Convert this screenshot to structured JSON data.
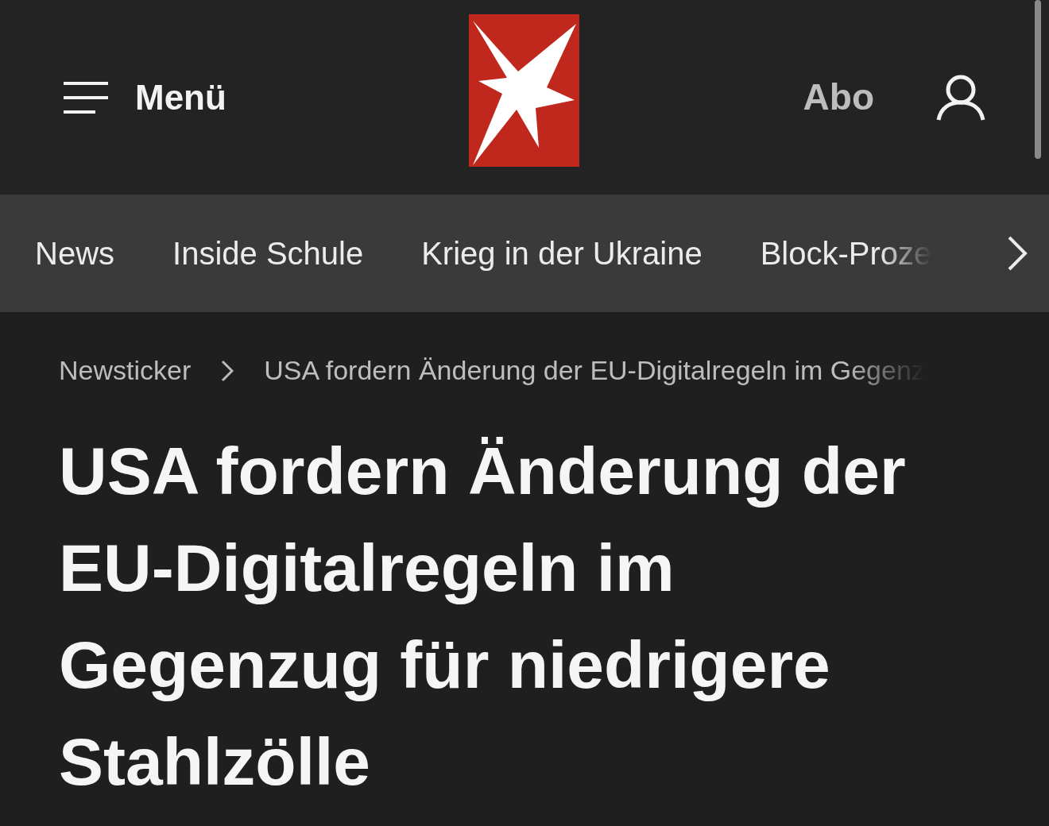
{
  "header": {
    "menu_label": "Menü",
    "abo_label": "Abo"
  },
  "nav": {
    "items": [
      {
        "label": "News"
      },
      {
        "label": "Inside Schule"
      },
      {
        "label": "Krieg in der Ukraine"
      },
      {
        "label": "Block-Proze"
      }
    ]
  },
  "breadcrumb": [
    {
      "label": "Newsticker"
    },
    {
      "label": "USA fordern Änderung der EU-Digitalregeln im Gegenz"
    }
  ],
  "headline": "USA fordern Änderung der EU-Digitalregeln im Gegenzug für niedrigere Stahlzölle"
}
